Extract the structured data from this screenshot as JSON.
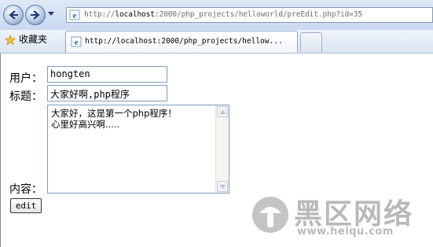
{
  "browser": {
    "address": {
      "prefix": "http://",
      "host": "localhost",
      "rest": ":2000/php_projects/helloworld/preEdit.php?id=35"
    },
    "favorites_label": "收藏夹",
    "tab_title": "http://localhost:2000/php_projects/hellow..."
  },
  "form": {
    "user_label": "用户：",
    "user_value": "hongten",
    "title_label": "标题：",
    "title_value": "大家好啊,php程序",
    "content_label": "内容：",
    "content_lines": [
      "大家好，这是第一个php程序！",
      "心里好高兴啊....."
    ],
    "edit_label": "edit"
  },
  "watermark": {
    "title": "黑区网络",
    "url": "www.heiqu.com"
  },
  "colors": {
    "chrome_blue": "#c9d9ef",
    "border": "#7f9db9",
    "watermark_gray": "#b9b9b9"
  }
}
